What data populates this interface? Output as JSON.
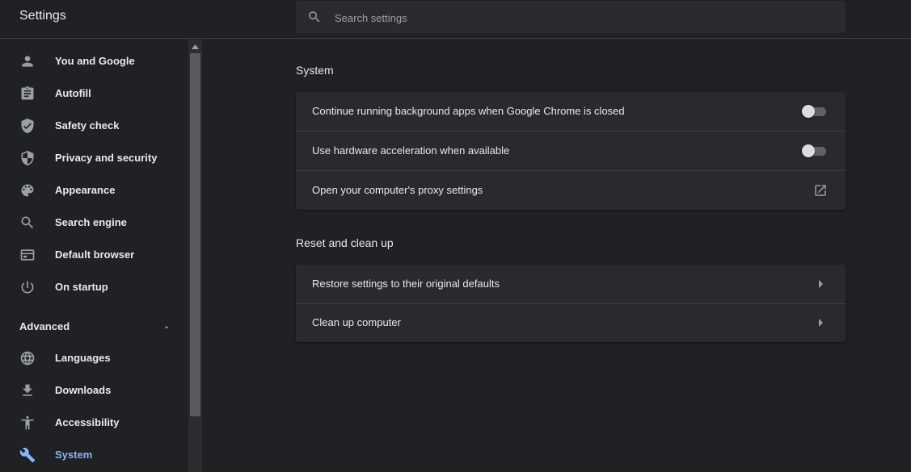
{
  "header": {
    "title": "Settings",
    "search_placeholder": "Search settings"
  },
  "sidebar": {
    "items": [
      {
        "label": "You and Google",
        "icon": "person-icon"
      },
      {
        "label": "Autofill",
        "icon": "clipboard-icon"
      },
      {
        "label": "Safety check",
        "icon": "shield-check-icon"
      },
      {
        "label": "Privacy and security",
        "icon": "shield-icon"
      },
      {
        "label": "Appearance",
        "icon": "palette-icon"
      },
      {
        "label": "Search engine",
        "icon": "search-icon"
      },
      {
        "label": "Default browser",
        "icon": "browser-icon"
      },
      {
        "label": "On startup",
        "icon": "power-icon"
      }
    ],
    "advanced_label": "Advanced",
    "advanced_items": [
      {
        "label": "Languages",
        "icon": "globe-icon"
      },
      {
        "label": "Downloads",
        "icon": "download-icon"
      },
      {
        "label": "Accessibility",
        "icon": "accessibility-icon"
      },
      {
        "label": "System",
        "icon": "wrench-icon",
        "active": true
      }
    ]
  },
  "main": {
    "system": {
      "title": "System",
      "rows": [
        {
          "label": "Continue running background apps when Google Chrome is closed",
          "toggle": false
        },
        {
          "label": "Use hardware acceleration when available",
          "toggle": false
        },
        {
          "label": "Open your computer's proxy settings",
          "icon": "external-link-icon"
        }
      ]
    },
    "reset": {
      "title": "Reset and clean up",
      "rows": [
        {
          "label": "Restore settings to their original defaults",
          "icon": "arrow-right-icon"
        },
        {
          "label": "Clean up computer",
          "icon": "arrow-right-icon"
        }
      ]
    }
  },
  "colors": {
    "background": "#202124",
    "card": "#292a2d",
    "accent": "#8ab4f8",
    "text": "#e8eaed"
  }
}
